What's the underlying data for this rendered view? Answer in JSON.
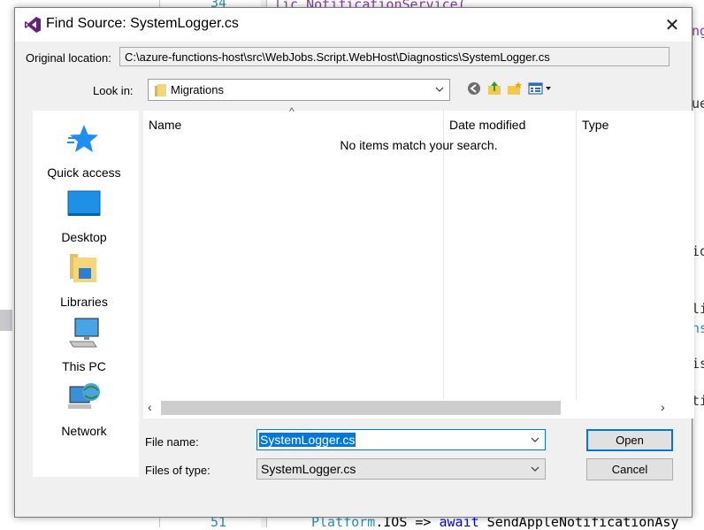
{
  "editor": {
    "fragments": [
      "lic NotificationService(",
      "ng",
      "ue",
      "io",
      "li",
      "ns",
      "is",
      "ti"
    ],
    "line_top": "34",
    "line_bottom": "51",
    "code_bottom": {
      "type_name": "Platform",
      "member": ".IOS => ",
      "keyword": "await",
      "call": " SendAppleNotificationAsy"
    }
  },
  "dialog": {
    "title": "Find Source: SystemLogger.cs",
    "close_glyph": "✕",
    "original_location_label": "Original location:",
    "original_location_value": "C:\\azure-functions-host\\src\\WebJobs.Script.WebHost\\Diagnostics\\SystemLogger.cs",
    "look_in_label": "Look in:",
    "look_in_value": "Migrations",
    "toolbar_icons": [
      "back-icon",
      "up-folder-icon",
      "new-folder-icon",
      "view-menu-icon"
    ],
    "places": [
      {
        "label": "Quick access",
        "icon": "star-icon"
      },
      {
        "label": "Desktop",
        "icon": "desktop-icon"
      },
      {
        "label": "Libraries",
        "icon": "libraries-icon"
      },
      {
        "label": "This PC",
        "icon": "computer-icon"
      },
      {
        "label": "Network",
        "icon": "network-icon"
      }
    ],
    "columns": [
      "Name",
      "Date modified",
      "Type"
    ],
    "empty_message": "No items match your search.",
    "file_name_label": "File name:",
    "file_name_value": "SystemLogger.cs",
    "files_of_type_label": "Files of type:",
    "files_of_type_value": "SystemLogger.cs",
    "open_label": "Open",
    "cancel_label": "Cancel"
  },
  "colors": {
    "accent": "#0078d7",
    "dialog_bg": "#f0f0f0",
    "vs_purple": "#68217a"
  }
}
